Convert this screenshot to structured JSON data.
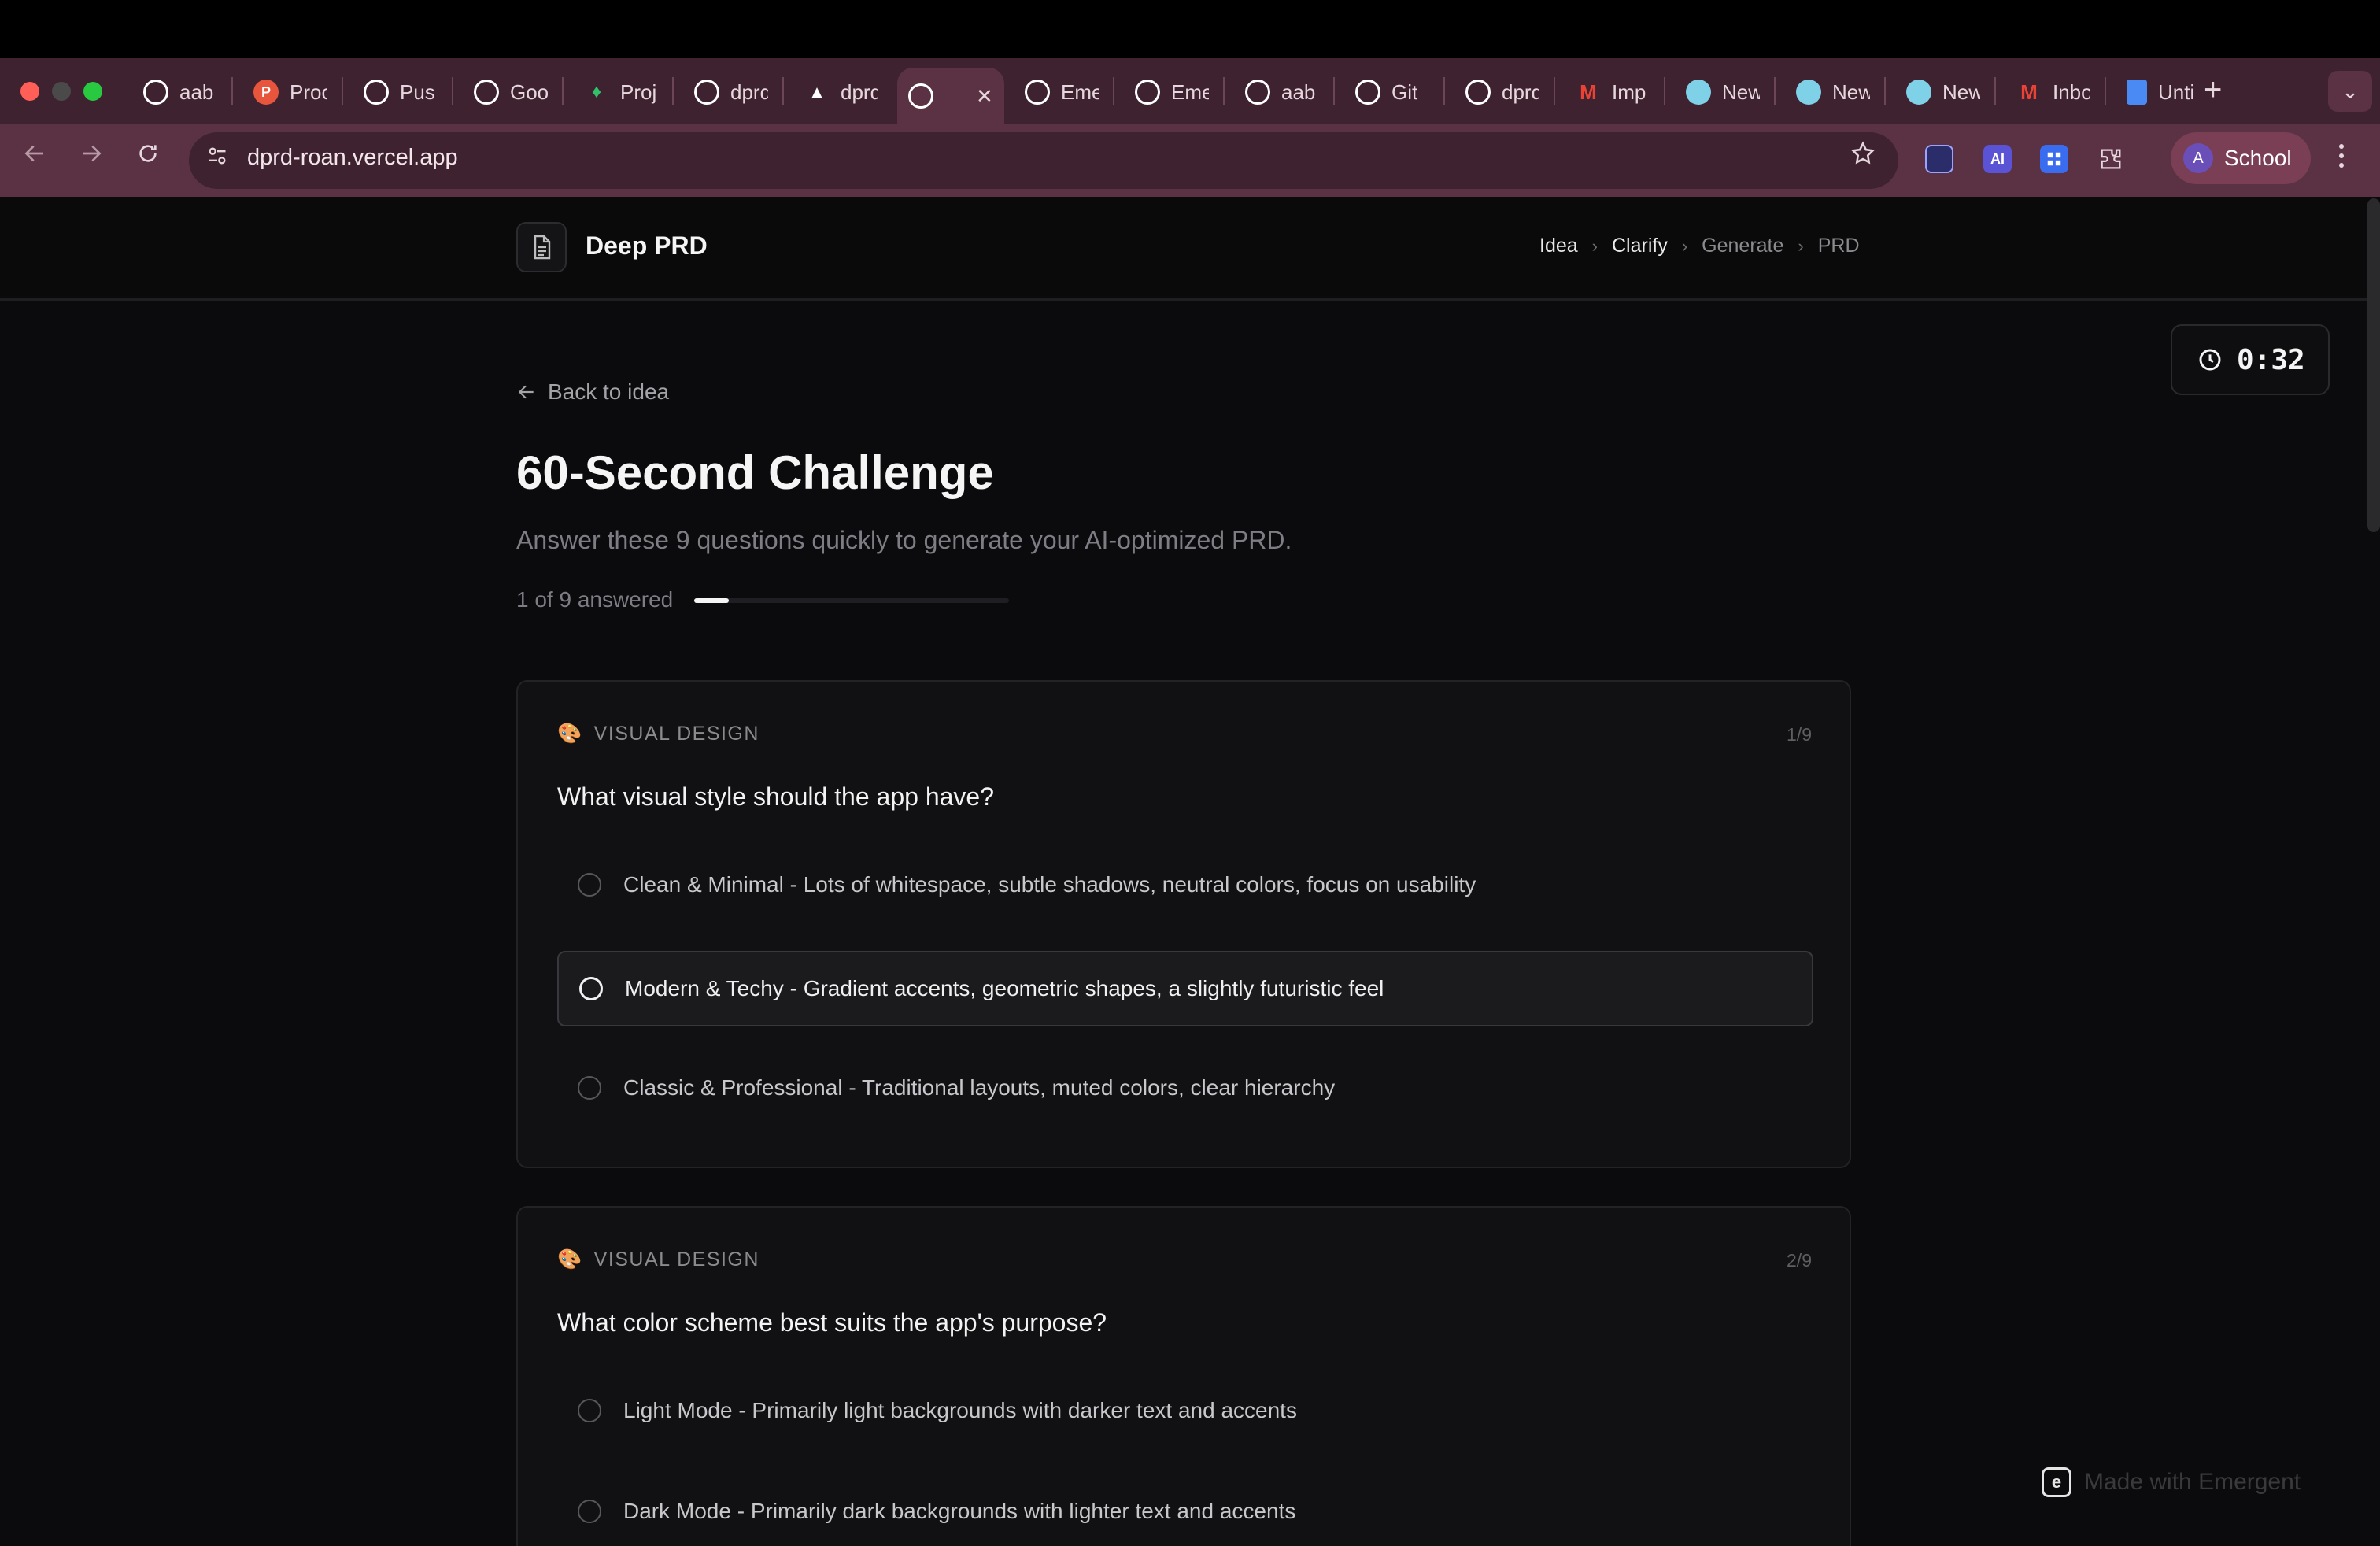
{
  "browser": {
    "tabs": [
      {
        "label": "aab",
        "icon": "github-icon",
        "color": "#ffffff"
      },
      {
        "label": "Proc",
        "icon": "producthunt-icon",
        "color": "#e8553d"
      },
      {
        "label": "Pus",
        "icon": "openai-icon",
        "color": "#ffffff"
      },
      {
        "label": "Goo",
        "icon": "app-icon",
        "color": "#ffffff"
      },
      {
        "label": "Proj",
        "icon": "leaf-icon",
        "color": "#2ec36b"
      },
      {
        "label": "dprd",
        "icon": "link-icon",
        "color": "#ffffff"
      },
      {
        "label": "dprd",
        "icon": "vercel-icon",
        "color": "#ffffff"
      },
      {
        "label": "",
        "icon": "globe-icon",
        "color": "#ffffff",
        "active": true
      },
      {
        "label": "Eme",
        "icon": "globe-icon",
        "color": "#ffffff"
      },
      {
        "label": "Eme",
        "icon": "globe-icon",
        "color": "#ffffff"
      },
      {
        "label": "aab",
        "icon": "github-icon",
        "color": "#ffffff"
      },
      {
        "label": "Git",
        "icon": "openai-icon",
        "color": "#ffffff"
      },
      {
        "label": "dprd",
        "icon": "globe-icon",
        "color": "#ffffff"
      },
      {
        "label": "Imp",
        "icon": "gmail-icon",
        "color": "#ea4335"
      },
      {
        "label": "New",
        "icon": "notion-icon",
        "color": "#7fd1e8"
      },
      {
        "label": "New",
        "icon": "notion-icon",
        "color": "#7fd1e8"
      },
      {
        "label": "New",
        "icon": "notion-icon",
        "color": "#7fd1e8"
      },
      {
        "label": "Inbo",
        "icon": "gmail-icon",
        "color": "#ea4335"
      },
      {
        "label": "Unti",
        "icon": "docs-icon",
        "color": "#4a8af4"
      }
    ],
    "new_tab": "+",
    "tab_menu": "⌄",
    "url": "dprd-roan.vercel.app",
    "profile_initial": "A",
    "profile_name": "School",
    "ext_ai_label": "AI"
  },
  "app": {
    "brand": "Deep PRD",
    "breadcrumb": [
      {
        "label": "Idea",
        "active": true
      },
      {
        "label": "Clarify",
        "active": true
      },
      {
        "label": "Generate",
        "active": false
      },
      {
        "label": "PRD",
        "active": false
      }
    ],
    "timer": "0:32",
    "back_label": "Back to idea",
    "title": "60-Second Challenge",
    "subtitle": "Answer these 9 questions quickly to generate your AI-optimized PRD.",
    "progress_label": "1 of 9 answered",
    "progress": {
      "answered": 1,
      "total": 9
    },
    "questions": [
      {
        "category": "VISUAL DESIGN",
        "category_icon": "palette-icon",
        "number": "1/9",
        "question": "What visual style should the app have?",
        "options": [
          "Clean & Minimal - Lots of whitespace, subtle shadows, neutral colors, focus on usability",
          "Modern & Techy - Gradient accents, geometric shapes, a slightly futuristic feel",
          "Classic & Professional - Traditional layouts, muted colors, clear hierarchy"
        ],
        "hovered_option": 1
      },
      {
        "category": "VISUAL DESIGN",
        "category_icon": "palette-icon",
        "number": "2/9",
        "question": "What color scheme best suits the app's purpose?",
        "options": [
          "Light Mode - Primarily light backgrounds with darker text and accents",
          "Dark Mode - Primarily dark backgrounds with lighter text and accents"
        ]
      }
    ],
    "badge": "Made with Emergent"
  }
}
